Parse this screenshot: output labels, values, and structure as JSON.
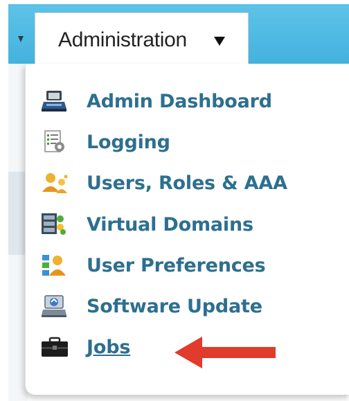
{
  "nav": {
    "active_tab_label": "Administration"
  },
  "menu": {
    "items": [
      {
        "label": "Admin Dashboard",
        "icon": "dashboard-icon"
      },
      {
        "label": "Logging",
        "icon": "logging-icon"
      },
      {
        "label": "Users, Roles & AAA",
        "icon": "users-icon"
      },
      {
        "label": "Virtual Domains",
        "icon": "virtual-domains-icon"
      },
      {
        "label": "User Preferences",
        "icon": "user-preferences-icon"
      },
      {
        "label": "Software Update",
        "icon": "software-update-icon"
      },
      {
        "label": "Jobs",
        "icon": "jobs-icon"
      }
    ]
  },
  "annotation": {
    "arrow_color": "#e03b2b"
  },
  "colors": {
    "nav_bar": "#44b2de",
    "menu_link": "#2d6f90"
  }
}
